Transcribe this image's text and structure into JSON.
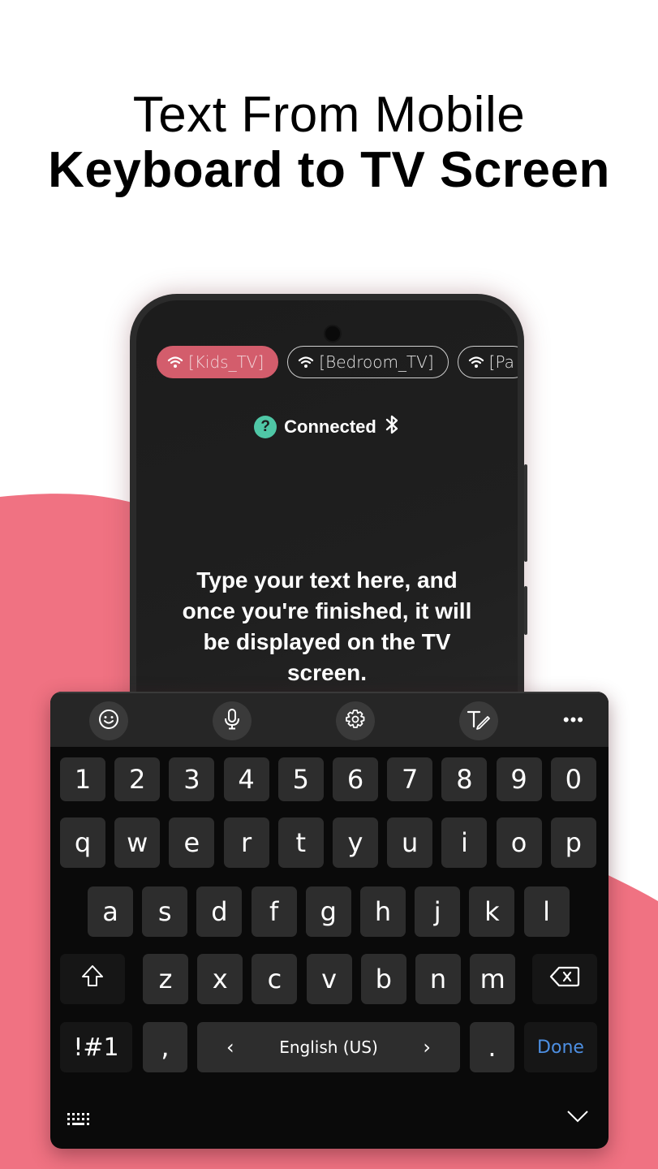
{
  "headline": {
    "line1": "Text From Mobile",
    "line2": "Keyboard to TV Screen"
  },
  "colors": {
    "accent_pink": "#f07282",
    "chip_active": "#d35d6c",
    "status_icon": "#4fc7a6",
    "done_blue": "#4d8fe2"
  },
  "app": {
    "devices": [
      {
        "label": "[Kids_TV]",
        "icon": "wifi-icon",
        "active": true
      },
      {
        "label": "[Bedroom_TV]",
        "icon": "wifi-icon",
        "active": false
      },
      {
        "label": "[Pa",
        "icon": "wifi-icon",
        "active": false
      }
    ],
    "status": {
      "help_icon_glyph": "?",
      "text": "Connected",
      "icon": "bluetooth-icon"
    },
    "placeholder": "Type your text here, and once you're finished, it will be displayed on the TV screen."
  },
  "keyboard": {
    "toolbar": [
      "emoji-icon",
      "microphone-icon",
      "settings-icon",
      "handwriting-icon",
      "more-icon"
    ],
    "more_glyph": "•••",
    "row_numbers": [
      "1",
      "2",
      "3",
      "4",
      "5",
      "6",
      "7",
      "8",
      "9",
      "0"
    ],
    "row1": [
      "q",
      "w",
      "e",
      "r",
      "t",
      "y",
      "u",
      "i",
      "o",
      "p"
    ],
    "row2": [
      "a",
      "s",
      "d",
      "f",
      "g",
      "h",
      "j",
      "k",
      "l"
    ],
    "row3": [
      "z",
      "x",
      "c",
      "v",
      "b",
      "n",
      "m"
    ],
    "symbols_label": "!#1",
    "comma": ",",
    "language": "English (US)",
    "lang_prev": "‹",
    "lang_next": "›",
    "period": ".",
    "done_label": "Done"
  }
}
